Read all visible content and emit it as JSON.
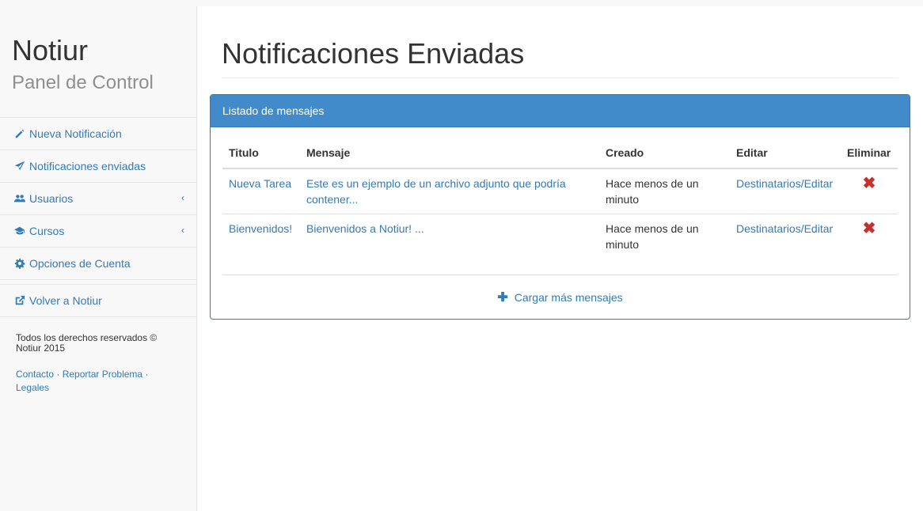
{
  "brand": {
    "title": "Notiur",
    "subtitle": "Panel de Control"
  },
  "nav": {
    "items": [
      {
        "label": "Nueva Notificación",
        "icon": "pencil-icon"
      },
      {
        "label": "Notificaciones enviadas",
        "icon": "paper-plane-icon"
      },
      {
        "label": "Usuarios",
        "icon": "users-icon",
        "chevron": "‹"
      },
      {
        "label": "Cursos",
        "icon": "graduation-cap-icon",
        "chevron": "‹"
      },
      {
        "label": "Opciones de Cuenta",
        "icon": "gear-icon"
      }
    ],
    "back": {
      "label": "Volver a Notiur",
      "icon": "external-link-icon"
    }
  },
  "footer": {
    "rights": "Todos los derechos reservados © Notiur 2015",
    "links": [
      "Contacto",
      "Reportar Problema",
      "Legales"
    ]
  },
  "main": {
    "title": "Notificaciones Enviadas",
    "panel": {
      "heading": "Listado de mensajes",
      "columns": [
        "Titulo",
        "Mensaje",
        "Creado",
        "Editar",
        "Eliminar"
      ],
      "rows": [
        {
          "titulo": "Nueva Tarea",
          "mensaje": "Este es un ejemplo de un archivo adjunto que podría contener...",
          "creado": "Hace menos de un minuto",
          "editar": "Destinatarios/Editar",
          "eliminar": "✖"
        },
        {
          "titulo": "Bienvenidos!",
          "mensaje": "Bienvenidos a Notiur! ...",
          "creado": "Hace menos de un minuto",
          "editar": "Destinatarios/Editar",
          "eliminar": "✖"
        }
      ],
      "load_more": "Cargar más mensajes"
    }
  },
  "colors": {
    "accent": "#337ab7",
    "panel_heading": "#428bca",
    "delete": "#c9302c"
  }
}
